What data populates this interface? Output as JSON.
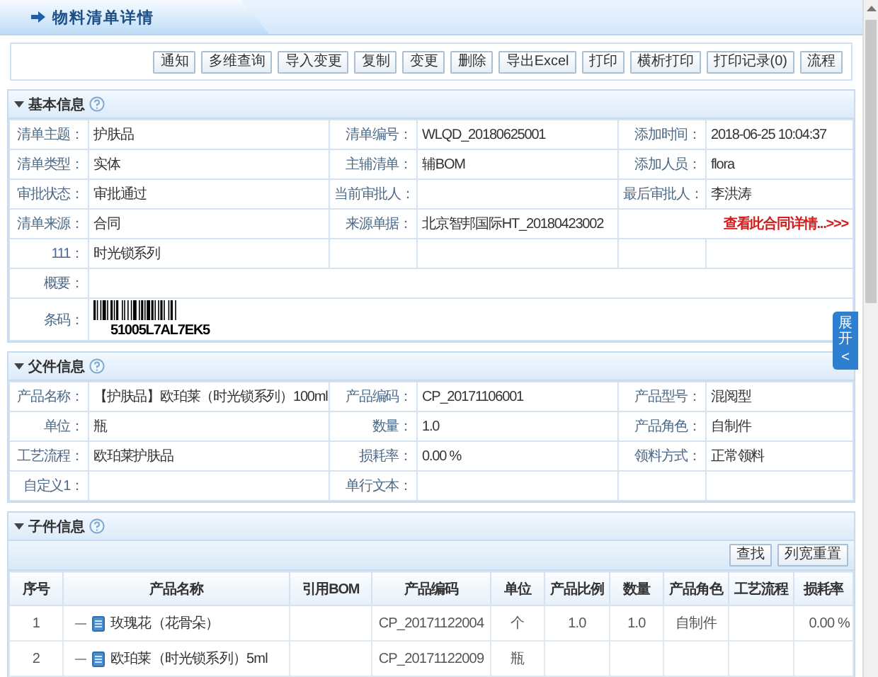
{
  "header": {
    "title": "物料清单详情"
  },
  "toolbar": {
    "buttons": [
      "通知",
      "多维查询",
      "导入变更",
      "复制",
      "变更",
      "删除",
      "导出Excel",
      "打印",
      "横析打印",
      "打印记录(0)",
      "流程"
    ]
  },
  "basic_info": {
    "title": "基本信息",
    "expanded": true,
    "rows": [
      {
        "kind": "grid",
        "fields": [
          {
            "label": "清单主题：",
            "value": "护肤品"
          },
          {
            "label": "清单编号：",
            "value": "WLQD_20180625001"
          },
          {
            "label": "添加时间：",
            "value": "2018-06-25 10:04:37"
          }
        ]
      },
      {
        "kind": "grid",
        "fields": [
          {
            "label": "清单类型：",
            "value": "实体"
          },
          {
            "label": "主辅清单：",
            "value": "辅BOM"
          },
          {
            "label": "添加人员：",
            "value": "flora"
          }
        ]
      },
      {
        "kind": "grid",
        "fields": [
          {
            "label": "审批状态：",
            "value": "审批通过"
          },
          {
            "label": "当前审批人："
          },
          {
            "label": "最后审批人：",
            "value": "李洪涛"
          }
        ]
      },
      {
        "kind": "grid",
        "fields": [
          {
            "label": "清单来源：",
            "value": "合同"
          },
          {
            "label": "来源单据：",
            "value": "北京智邦国际HT_20180423002"
          },
          {
            "link": "查看此合同详情...>>>"
          }
        ]
      },
      {
        "kind": "grid",
        "fields": [
          {
            "label": "111：",
            "value": "时光锁系列"
          }
        ]
      },
      {
        "kind": "full",
        "label": "概要："
      },
      {
        "kind": "barcode",
        "label": "条码：",
        "code": "51005L7AL7EK5"
      }
    ]
  },
  "parent_info": {
    "title": "父件信息",
    "expanded": true,
    "rows": [
      {
        "kind": "grid",
        "fields": [
          {
            "label": "产品名称：",
            "value": "【护肤品】欧珀莱（时光锁系列）100ml"
          },
          {
            "label": "产品编码：",
            "value": "CP_20171106001"
          },
          {
            "label": "产品型号：",
            "value": "混阅型"
          }
        ]
      },
      {
        "kind": "grid",
        "fields": [
          {
            "label": "单位：",
            "value": "瓶"
          },
          {
            "label": "数量：",
            "value": "1.0"
          },
          {
            "label": "产品角色：",
            "value": "自制件"
          }
        ]
      },
      {
        "kind": "grid",
        "fields": [
          {
            "label": "工艺流程：",
            "value": "欧珀莱护肤品"
          },
          {
            "label": "损耗率：",
            "value": "0.00 %"
          },
          {
            "label": "领料方式：",
            "value": "正常领料"
          }
        ]
      },
      {
        "kind": "grid",
        "fields": [
          {
            "label": "自定义1："
          },
          {
            "label": "单行文本："
          }
        ]
      }
    ]
  },
  "child_info": {
    "title": "子件信息",
    "expanded": true,
    "buttons": [
      "查找",
      "列宽重置"
    ],
    "columns": [
      "序号",
      "产品名称",
      "引用BOM",
      "产品编码",
      "单位",
      "产品比例",
      "数量",
      "产品角色",
      "工艺流程",
      "损耗率"
    ],
    "rows": [
      {
        "cells": [
          "1",
          "玫瑰花（花骨朵）",
          "",
          "CP_20171122004",
          "个",
          "1.0",
          "1.0",
          "自制件",
          "",
          "0.00 %"
        ]
      },
      {
        "cells": [
          "2",
          "欧珀莱（时光锁系列）5ml",
          "",
          "CP_20171122009",
          "瓶"
        ]
      }
    ]
  },
  "side_tab": {
    "label": "展开",
    "arrow": "<"
  }
}
